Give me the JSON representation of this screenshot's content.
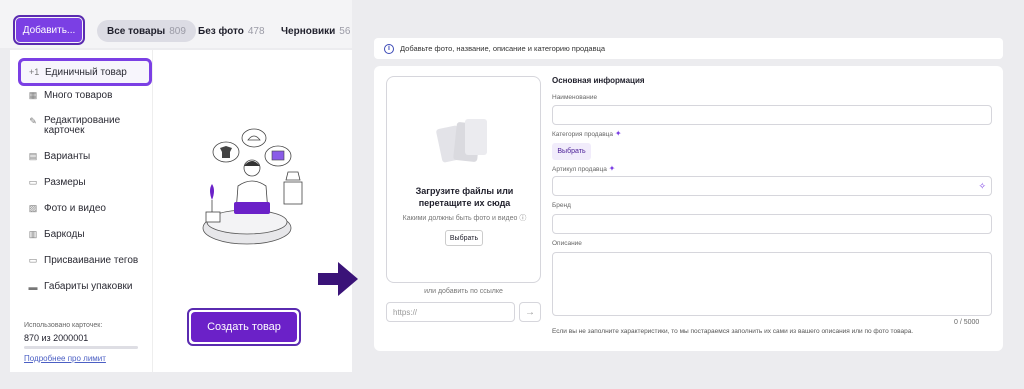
{
  "toolbar": {
    "add_label": "Добавить...",
    "tabs": [
      {
        "label": "Все товары",
        "count": "809"
      },
      {
        "label": "Без фото",
        "count": "478"
      },
      {
        "label": "Черновики",
        "count": "56"
      }
    ]
  },
  "menu": {
    "items": [
      {
        "label": "Единичный товар",
        "icon": "plus-one-icon"
      },
      {
        "label": "Много товаров",
        "icon": "grid-icon"
      },
      {
        "label": "Редактирование карточек",
        "icon": "pencil-icon"
      },
      {
        "label": "Варианты",
        "icon": "variants-icon"
      },
      {
        "label": "Размеры",
        "icon": "ruler-icon"
      },
      {
        "label": "Фото и видео",
        "icon": "image-icon"
      },
      {
        "label": "Баркоды",
        "icon": "barcode-icon"
      },
      {
        "label": "Присваивание тегов",
        "icon": "tag-icon"
      },
      {
        "label": "Габариты упаковки",
        "icon": "box-icon"
      }
    ],
    "usage_label": "Использовано карточек:",
    "usage_value": "870 из 2000001",
    "usage_fraction": 0.0004,
    "limit_link": "Подробнее про лимит"
  },
  "create_button": "Создать товар",
  "form": {
    "banner": "Добавьте фото, название, описание и категорию продавца",
    "upload_title_1": "Загрузите файлы или",
    "upload_title_2": "перетащите их сюда",
    "upload_hint": "Какими должны быть фото и видео",
    "upload_choose": "Выбрать",
    "link_label": "или добавить по ссылке",
    "url_placeholder": "https://",
    "section_title": "Основная информация",
    "name_label": "Наименование",
    "category_label": "Категория продавца",
    "category_choose": "Выбрать",
    "article_label": "Артикул продавца",
    "brand_label": "Бренд",
    "description_label": "Описание",
    "counter": "0 / 5000",
    "footnote": "Если вы не заполните характеристики, то мы постараемся заполнить их сами из вашего описания или по фото товара."
  },
  "colors": {
    "accent": "#7b3fe4",
    "accent_dark": "#6b21c8",
    "link": "#4b5fc4"
  }
}
